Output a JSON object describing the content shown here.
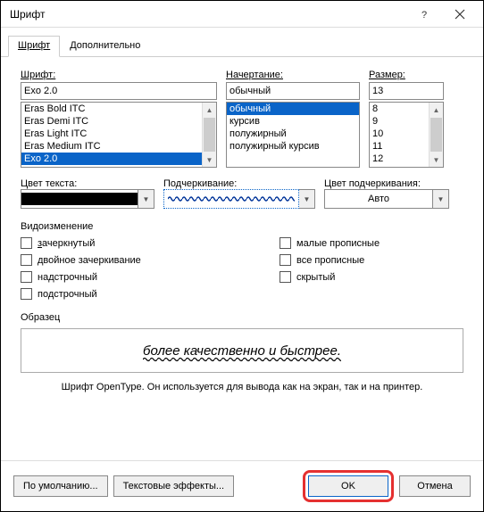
{
  "title": "Шрифт",
  "tabs": {
    "font": "Шрифт",
    "advanced": "Дополнительно"
  },
  "labels": {
    "font": "Шрифт:",
    "style": "Начертание:",
    "size": "Размер:",
    "textcolor": "Цвет текста:",
    "underline": "Подчеркивание:",
    "ulcolor": "Цвет подчеркивания:",
    "effects": "Видоизменение",
    "sample": "Образец"
  },
  "font": {
    "value": "Exo 2.0",
    "items": [
      "Eras Bold ITC",
      "Eras Demi ITC",
      "Eras Light ITC",
      "Eras Medium ITC",
      "Exo 2.0"
    ],
    "selectedIndex": 4
  },
  "style": {
    "value": "обычный",
    "items": [
      "обычный",
      "курсив",
      "полужирный",
      "полужирный курсив"
    ],
    "selectedIndex": 0
  },
  "size": {
    "value": "13",
    "items": [
      "8",
      "9",
      "10",
      "11",
      "12"
    ]
  },
  "ulcolor_value": "Авто",
  "effects": {
    "strike": "зачеркнутый",
    "dstrike": "двойное зачеркивание",
    "superscript": "надстрочный",
    "subscript": "подстрочный",
    "smallcaps": "малые прописные",
    "allcaps": "все прописные",
    "hidden": "скрытый"
  },
  "sample_text": "более качественно и быстрее.",
  "note": "Шрифт OpenType. Он используется для вывода как на экран, так и на принтер.",
  "buttons": {
    "default": "По умолчанию...",
    "texteffects": "Текстовые эффекты...",
    "ok": "OK",
    "cancel": "Отмена"
  }
}
